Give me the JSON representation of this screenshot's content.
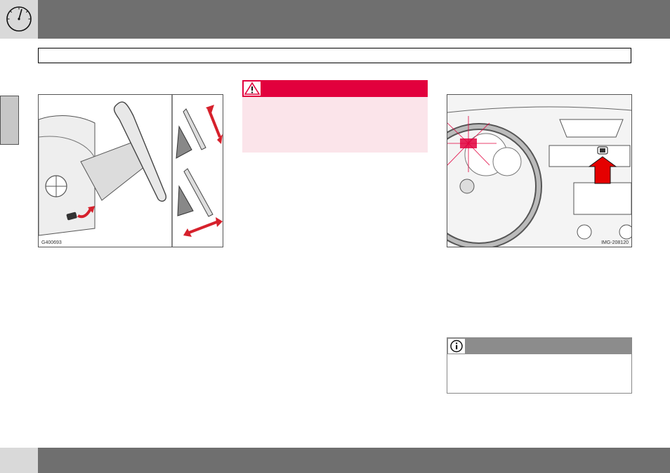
{
  "header": {
    "icon": "gauge-icon",
    "background_color": "#6f6f6f"
  },
  "figures": {
    "left": {
      "code": "G400693",
      "icon": "steering-wheel-adjustment-illustration"
    },
    "right": {
      "code": "IMG-208120",
      "icon": "dashboard-illustration"
    }
  },
  "warning": {
    "icon": "warning-triangle-icon",
    "header_color": "#e2003d",
    "body_color": "#fbe4ea"
  },
  "note": {
    "icon": "info-icon",
    "header_color": "#8c8c8c"
  },
  "footer": {
    "background_color": "#6f6f6f"
  }
}
